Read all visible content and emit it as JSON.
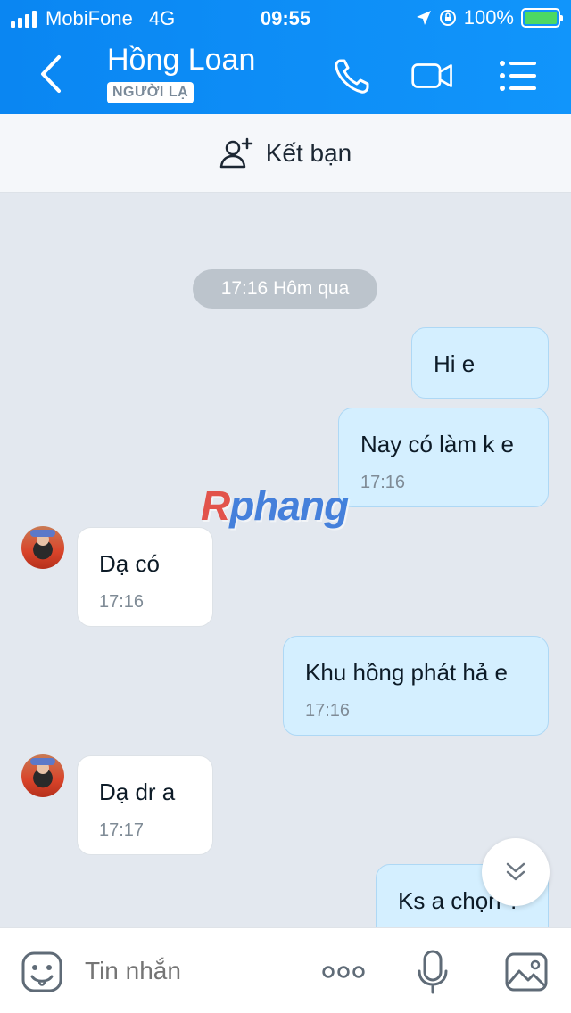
{
  "status": {
    "carrier": "MobiFone",
    "network": "4G",
    "time": "09:55",
    "battery": "100%"
  },
  "header": {
    "name": "Hồng Loan",
    "badge": "NGƯỜI LẠ"
  },
  "add_friend": {
    "label": "Kết bạn"
  },
  "chat": {
    "date_separator": "17:16 Hôm qua",
    "messages": [
      {
        "dir": "out",
        "text": "Hi e",
        "time": ""
      },
      {
        "dir": "out",
        "text": "Nay có làm k e",
        "time": "17:16"
      },
      {
        "dir": "in",
        "text": "Dạ có",
        "time": "17:16"
      },
      {
        "dir": "out",
        "text": "Khu hồng phát hả e",
        "time": "17:16"
      },
      {
        "dir": "in",
        "text": "Dạ dr a",
        "time": "17:17"
      },
      {
        "dir": "out",
        "text": "Ks a chọn ?",
        "time": ""
      }
    ]
  },
  "watermark": {
    "part1": "R",
    "part2": "phang"
  },
  "composer": {
    "placeholder": "Tin nhắn"
  },
  "colors": {
    "header": "#0a86f2",
    "outgoing_bubble": "#d4efff",
    "incoming_bubble": "#ffffff",
    "chat_bg": "#e3e8ef"
  }
}
